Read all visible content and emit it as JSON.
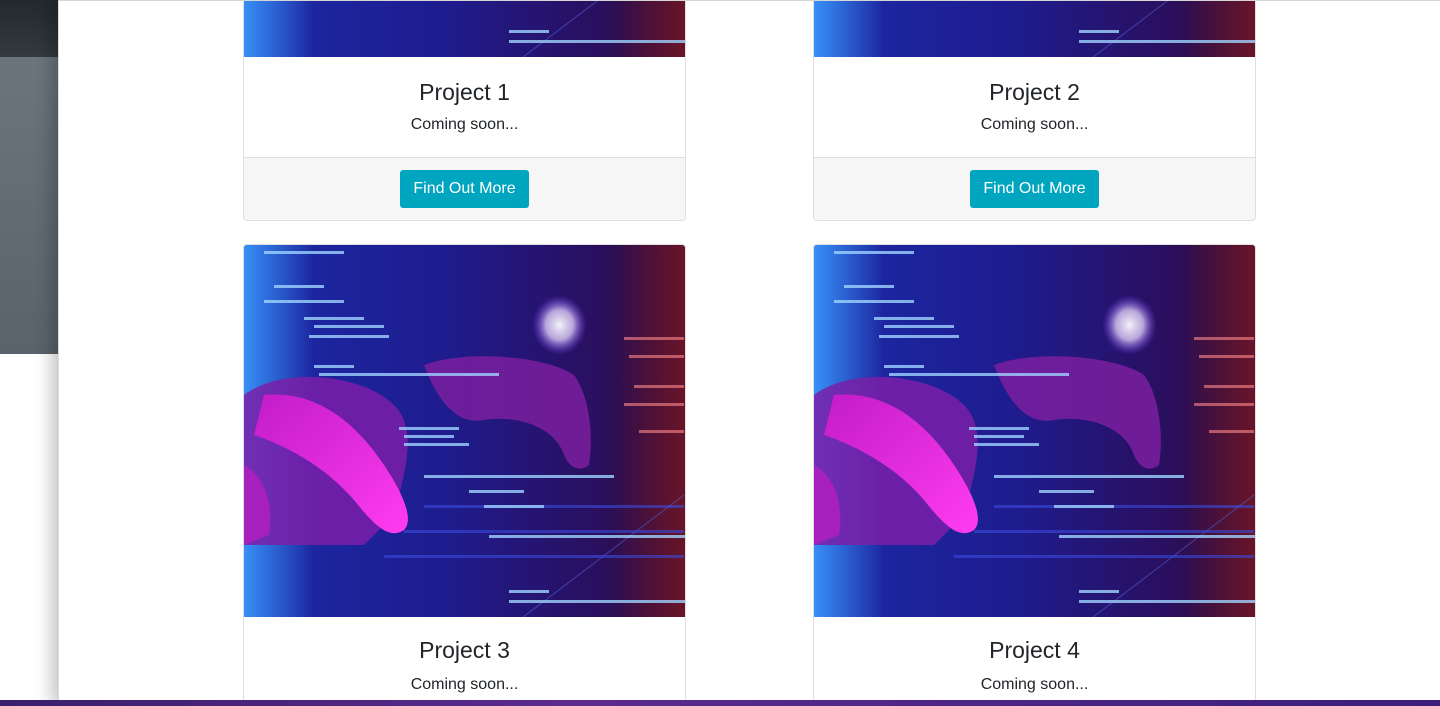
{
  "projects": [
    {
      "title": "Project 1",
      "text": "Coming soon...",
      "button": "Find Out More"
    },
    {
      "title": "Project 2",
      "text": "Coming soon...",
      "button": "Find Out More"
    },
    {
      "title": "Project 3",
      "text": "Coming soon..."
    },
    {
      "title": "Project 4",
      "text": "Coming soon..."
    }
  ],
  "colors": {
    "button": "#00a5bf",
    "footer_bg": "#f6f6f6",
    "image_primary": "#1a1f8c",
    "image_accent": "#e21bd8"
  },
  "image": {
    "icon": "code-hands-keyboard-image"
  }
}
